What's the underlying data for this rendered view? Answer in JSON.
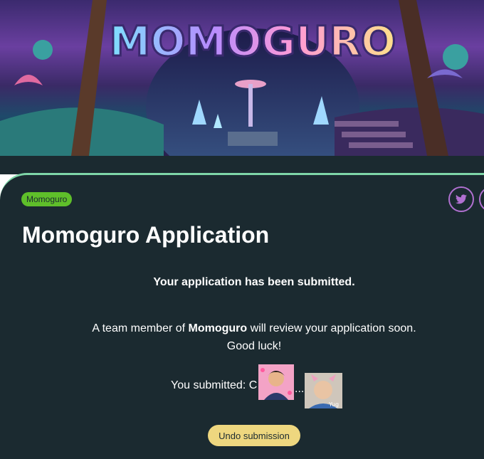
{
  "banner": {
    "logo_text": "MOMOGURO"
  },
  "tag": "Momoguro",
  "title": "Momoguro Application",
  "message": {
    "line1": "Your application has been submitted.",
    "line2_prefix": "A team member of ",
    "line2_bold": "Momoguro",
    "line2_suffix": " will review your application soon.",
    "line3": "Good luck!"
  },
  "submitted": {
    "label": "You submitted: C",
    "ellipsis": "...",
    "thumb2_caption": "Yug"
  },
  "undo_button": "Undo submission",
  "colors": {
    "card_bg": "#1b2a30",
    "accent_border": "#7fd6a8",
    "tag_bg": "#5fbf2a",
    "button_bg": "#eed77f",
    "social_border": "#b070d0"
  },
  "icons": [
    "twitter-icon"
  ]
}
